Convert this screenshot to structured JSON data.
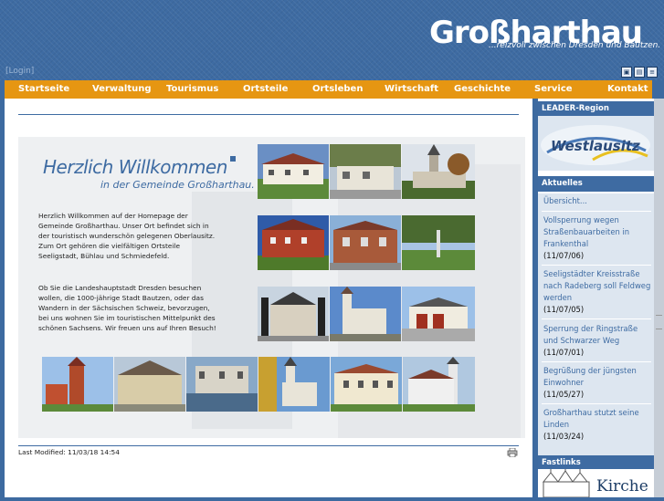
{
  "header": {
    "logo_title": "Großharthau",
    "logo_subtitle": "...reizvoll zwischen Dresden und Bautzen.",
    "login_label": "[Login]"
  },
  "nav": {
    "items": [
      {
        "label": "Startseite"
      },
      {
        "label": "Verwaltung"
      },
      {
        "label": "Tourismus"
      },
      {
        "label": "Ortsteile"
      },
      {
        "label": "Ortsleben"
      },
      {
        "label": "Wirtschaft"
      },
      {
        "label": "Geschichte"
      },
      {
        "label": "Service"
      },
      {
        "label": "Kontakt"
      }
    ]
  },
  "main": {
    "welcome_line1": "Herzlich Willkommen",
    "welcome_line2": "in der Gemeinde Großharthau.",
    "intro_paragraph1": "Herzlich Willkommen auf der Homepage der Gemeinde Großharthau. Unser Ort befindet sich in der touristisch wunderschön gelegenen Oberlausitz. Zum Ort gehören die vielfältigen Ortsteile Seeligstadt, Bühlau und Schmiedefeld.",
    "intro_paragraph2": "Ob Sie die Landeshauptstadt Dresden besuchen wollen, die 1000-jährige Stadt Bautzen, oder das Wandern in der Sächsischen Schweiz, bevorzugen, bei uns wohnen Sie im touristischen Mittelpunkt des schönen Sachsens. Wir freuen uns auf Ihren Besuch!",
    "last_modified": "Last Modified: 11/03/18 14:54"
  },
  "sidebar": {
    "leader_heading": "LEADER-Region",
    "leader_logo_text": "Westlausitz",
    "aktuelles_heading": "Aktuelles",
    "overview_link": "Übersicht...",
    "news": [
      {
        "title": "Vollsperrung wegen Straßenbauarbeiten in Frankenthal",
        "date": "(11/07/06)"
      },
      {
        "title": "Seeligstädter Kreisstraße nach Radeberg soll Feldweg werden",
        "date": "(11/07/05)"
      },
      {
        "title": "Sperrung der Ringstraße und Schwarzer Weg",
        "date": "(11/07/01)"
      },
      {
        "title": "Begrüßung der jüngsten Einwohner",
        "date": "(11/05/27)"
      },
      {
        "title": "Großharthau stutzt seine Linden",
        "date": "(11/03/24)"
      }
    ],
    "fastlinks_heading": "Fastlinks",
    "fastlinks_text": "Kirche"
  },
  "colors": {
    "header_blue": "#3e6ba2",
    "nav_orange": "#e69612",
    "sidebar_bg": "#dde6f0"
  }
}
